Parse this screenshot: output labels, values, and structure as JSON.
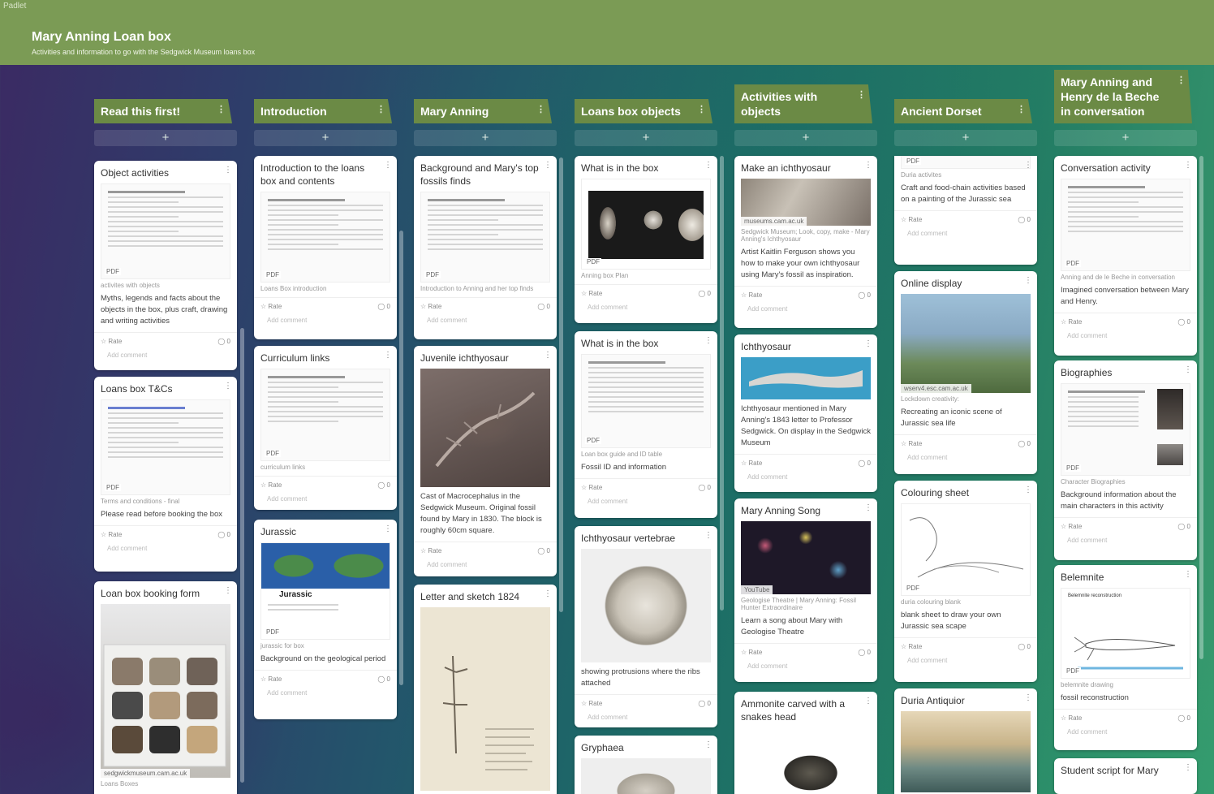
{
  "app": {
    "brand": "Padlet"
  },
  "board": {
    "title": "Mary Anning Loan box",
    "subtitle": "Activities and information to go with the Sedgwick Museum loans box"
  },
  "ui": {
    "rate": "Rate",
    "add_comment": "Add comment",
    "add": "+",
    "pdf": "PDF",
    "menu": "⋮",
    "zero": "0"
  },
  "columns": [
    {
      "title": "Read this first!",
      "cards": [
        {
          "title": "Object activities",
          "link": "activites with objects",
          "desc": "Myths, legends and facts about the objects in the box, plus craft, drawing and writing activities"
        },
        {
          "title": "Loans box T&Cs",
          "link": "Terms and conditions - final",
          "desc": "Please read before booking the box"
        },
        {
          "title": "Loan box booking form",
          "source": "sedgwickmuseum.cam.ac.uk",
          "link": "Loans Boxes"
        }
      ]
    },
    {
      "title": "Introduction",
      "cards": [
        {
          "title": "Introduction to the loans box and contents",
          "link": "Loans Box introduction"
        },
        {
          "title": "Curriculum links",
          "link": "curriculum links"
        },
        {
          "title": "Jurassic",
          "link": "jurassic for box",
          "desc": "Background on the geological period",
          "thumb_title": "Jurassic"
        }
      ]
    },
    {
      "title": "Mary Anning",
      "cards": [
        {
          "title": "Background and Mary's top fossils finds",
          "link": "Introduction to Anning and her top finds"
        },
        {
          "title": "Juvenile ichthyosaur",
          "desc": "Cast of Macrocephalus in the Sedgwick Museum. Original fossil found by Mary in 1830. The block is roughly 60cm square."
        },
        {
          "title": "Letter and sketch 1824"
        }
      ]
    },
    {
      "title": "Loans box objects",
      "cards": [
        {
          "title": "What is in the box",
          "link": "Anning box Plan"
        },
        {
          "title": "What is in the box",
          "link": "Loan box guide and ID table",
          "desc": "Fossil ID and information"
        },
        {
          "title": "Ichthyosaur vertebrae",
          "desc": "showing protrusions where the ribs attached"
        },
        {
          "title": "Gryphaea"
        }
      ]
    },
    {
      "title": "Activities with objects",
      "cards": [
        {
          "title": "Make an ichthyosaur",
          "source": "museums.cam.ac.uk",
          "link": "Sedgwick Museum; Look, copy, make - Mary Anning's Ichthyosaur",
          "desc": "Artist Kaitlin Ferguson shows you how to make your own ichthyosaur using Mary's fossil as inspiration."
        },
        {
          "title": "Ichthyosaur",
          "desc": "Ichthyosaur mentioned in Mary Anning's 1843 letter to Professor Sedgwick. On display in the Sedgwick Museum"
        },
        {
          "title": "Mary Anning Song",
          "source": "YouTube",
          "link": "Geologise Theatre | Mary Anning: Fossil Hunter Extraordinaire",
          "desc": "Learn a song about Mary with Geologise Theatre"
        },
        {
          "title": "Ammonite carved with a snakes head"
        }
      ]
    },
    {
      "title": "Ancient Dorset",
      "cards": [
        {
          "link": "Duria activites",
          "desc": "Craft and food-chain activities based on a painting of the Jurassic sea"
        },
        {
          "title": "Online display",
          "source": "wserv4.esc.cam.ac.uk",
          "link": "Lockdown creativity:",
          "desc": "Recreating an iconic scene of Jurassic sea life"
        },
        {
          "title": "Colouring sheet",
          "link": "duria colouring blank",
          "desc": "blank sheet to draw your own Jurassic sea scape"
        },
        {
          "title": "Duria Antiquior"
        }
      ]
    },
    {
      "title": "Mary Anning and Henry de la Beche in conversation",
      "cards": [
        {
          "title": "Conversation activity",
          "link": "Anning and de le Beche in conversation",
          "desc": "Imagined conversation between Mary and Henry."
        },
        {
          "title": "Biographies",
          "link": "Character Biographies",
          "desc": "Background information about the main characters in this activity"
        },
        {
          "title": "Belemnite",
          "link": "belemnite drawing",
          "desc": "fossil reconstruction",
          "thumb_title": "Belemnite reconstruction"
        },
        {
          "title": "Student script for Mary"
        }
      ]
    }
  ]
}
